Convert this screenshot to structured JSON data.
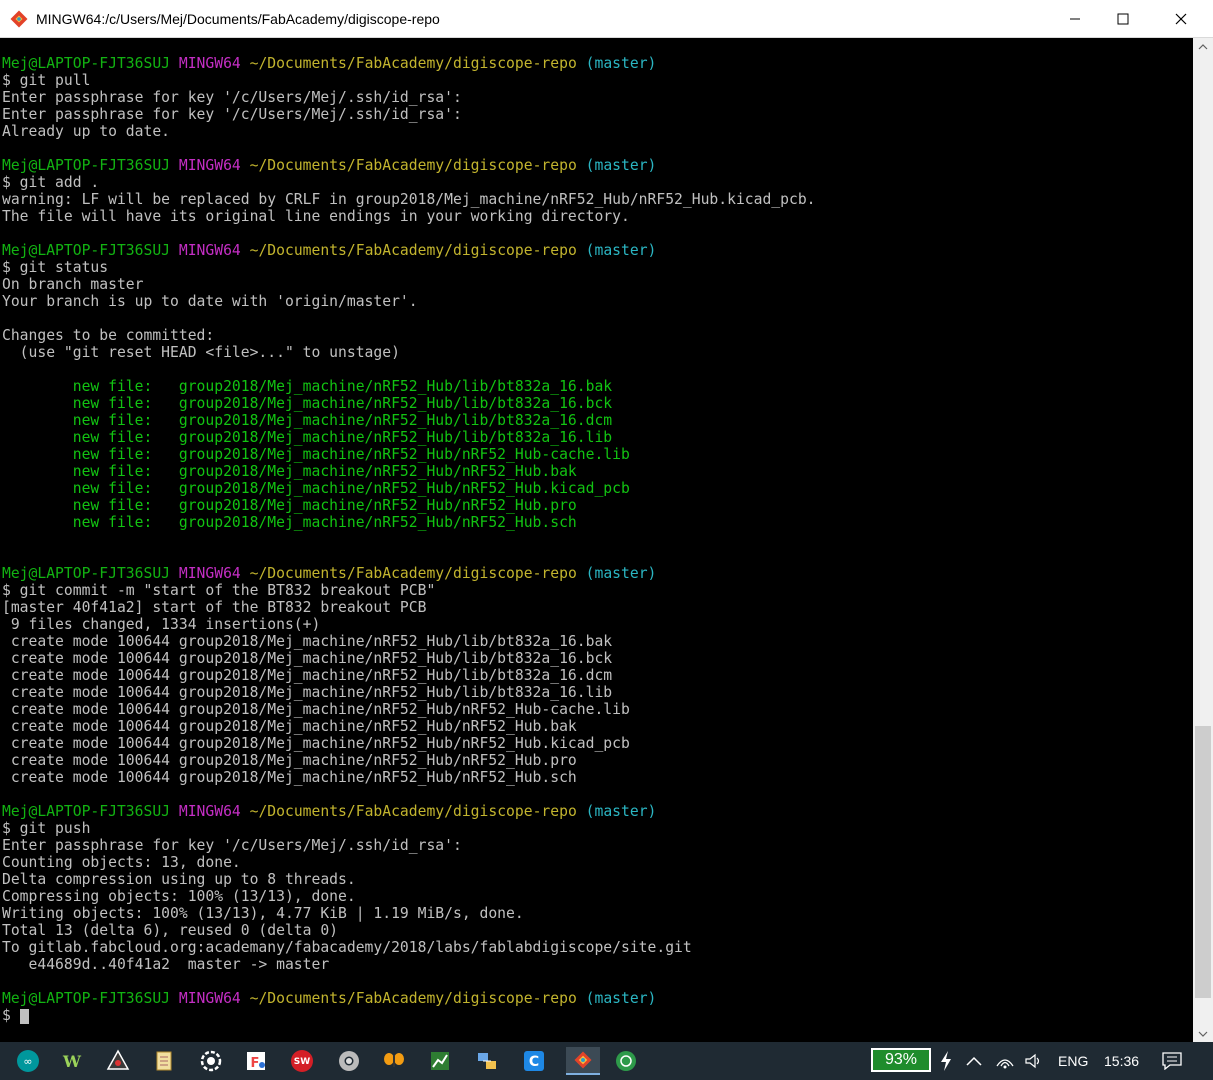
{
  "window": {
    "title": "MINGW64:/c/Users/Mej/Documents/FabAcademy/digiscope-repo"
  },
  "prompt": {
    "user": "Mej@LAPTOP-FJT36SUJ",
    "system": "MINGW64",
    "path": "~/Documents/FabAcademy/digiscope-repo",
    "branch": "(master)"
  },
  "terminal": {
    "cmd_pull": "$ git pull",
    "pull_out": [
      "Enter passphrase for key '/c/Users/Mej/.ssh/id_rsa':",
      "Enter passphrase for key '/c/Users/Mej/.ssh/id_rsa':",
      "Already up to date."
    ],
    "cmd_add": "$ git add .",
    "add_out": [
      "warning: LF will be replaced by CRLF in group2018/Mej_machine/nRF52_Hub/nRF52_Hub.kicad_pcb.",
      "The file will have its original line endings in your working directory."
    ],
    "cmd_status": "$ git status",
    "status_out": [
      "On branch master",
      "Your branch is up to date with 'origin/master'.",
      "",
      "Changes to be committed:",
      "  (use \"git reset HEAD <file>...\" to unstage)",
      ""
    ],
    "new_files": [
      "        new file:   group2018/Mej_machine/nRF52_Hub/lib/bt832a_16.bak",
      "        new file:   group2018/Mej_machine/nRF52_Hub/lib/bt832a_16.bck",
      "        new file:   group2018/Mej_machine/nRF52_Hub/lib/bt832a_16.dcm",
      "        new file:   group2018/Mej_machine/nRF52_Hub/lib/bt832a_16.lib",
      "        new file:   group2018/Mej_machine/nRF52_Hub/nRF52_Hub-cache.lib",
      "        new file:   group2018/Mej_machine/nRF52_Hub/nRF52_Hub.bak",
      "        new file:   group2018/Mej_machine/nRF52_Hub/nRF52_Hub.kicad_pcb",
      "        new file:   group2018/Mej_machine/nRF52_Hub/nRF52_Hub.pro",
      "        new file:   group2018/Mej_machine/nRF52_Hub/nRF52_Hub.sch"
    ],
    "cmd_commit": "$ git commit -m \"start of the BT832 breakout PCB\"",
    "commit_out": [
      "[master 40f41a2] start of the BT832 breakout PCB",
      " 9 files changed, 1334 insertions(+)",
      " create mode 100644 group2018/Mej_machine/nRF52_Hub/lib/bt832a_16.bak",
      " create mode 100644 group2018/Mej_machine/nRF52_Hub/lib/bt832a_16.bck",
      " create mode 100644 group2018/Mej_machine/nRF52_Hub/lib/bt832a_16.dcm",
      " create mode 100644 group2018/Mej_machine/nRF52_Hub/lib/bt832a_16.lib",
      " create mode 100644 group2018/Mej_machine/nRF52_Hub/nRF52_Hub-cache.lib",
      " create mode 100644 group2018/Mej_machine/nRF52_Hub/nRF52_Hub.bak",
      " create mode 100644 group2018/Mej_machine/nRF52_Hub/nRF52_Hub.kicad_pcb",
      " create mode 100644 group2018/Mej_machine/nRF52_Hub/nRF52_Hub.pro",
      " create mode 100644 group2018/Mej_machine/nRF52_Hub/nRF52_Hub.sch"
    ],
    "cmd_push": "$ git push",
    "push_out": [
      "Enter passphrase for key '/c/Users/Mej/.ssh/id_rsa':",
      "Counting objects: 13, done.",
      "Delta compression using up to 8 threads.",
      "Compressing objects: 100% (13/13), done.",
      "Writing objects: 100% (13/13), 4.77 KiB | 1.19 MiB/s, done.",
      "Total 13 (delta 6), reused 0 (delta 0)",
      "To gitlab.fabcloud.org:academany/fabacademy/2018/labs/fablabdigiscope/site.git",
      "   e44689d..40f41a2  master -> master"
    ],
    "final_prompt": "$"
  },
  "taskbar": {
    "battery": "93%",
    "language": "ENG",
    "time": "15:36",
    "icons": [
      "arduino-icon",
      "winavr-icon",
      "inkscape-icon",
      "notepad-icon",
      "settings-gear-icon",
      "foxit-icon",
      "solidworks-icon",
      "chrome-icon",
      "butterfly-icon",
      "chart-app-icon",
      "network-app-icon",
      "cura-icon",
      "git-icon",
      "circle-app-icon"
    ]
  },
  "colors": {
    "user": "#12b312",
    "system": "#c42ec4",
    "path": "#c2b42e",
    "branch": "#2bb6c3",
    "new_file": "#12c312"
  }
}
